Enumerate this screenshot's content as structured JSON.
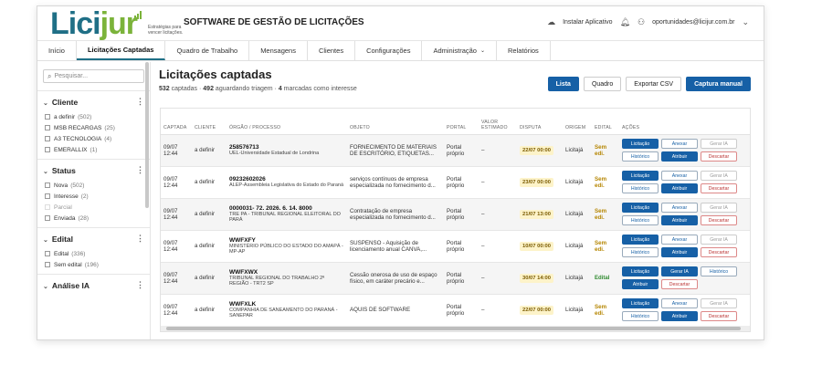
{
  "app": {
    "logo_text_a": "Lici",
    "logo_text_b": "jur",
    "logo_tagline": "Estratégias para vencer licitações.",
    "title": "SOFTWARE DE GESTÃO DE LICITAÇÕES",
    "install_label": "Instalar Aplicativo",
    "user_email": "oportunidades@licijur.com.br"
  },
  "tabs": [
    {
      "label": "Início"
    },
    {
      "label": "Licitações Captadas"
    },
    {
      "label": "Quadro de Trabalho"
    },
    {
      "label": "Mensagens"
    },
    {
      "label": "Clientes"
    },
    {
      "label": "Configurações"
    },
    {
      "label": "Administração"
    },
    {
      "label": "Relatórios"
    }
  ],
  "sidebar": {
    "search_placeholder": "Pesquisar...",
    "facets": {
      "cliente": {
        "title": "Cliente",
        "options": [
          {
            "label": "a definir",
            "count": "(502)"
          },
          {
            "label": "MSB RECARGAS",
            "count": "(25)"
          },
          {
            "label": "A3 TECNOLOGIA",
            "count": "(4)"
          },
          {
            "label": "EMERALLIX",
            "count": "(1)"
          }
        ]
      },
      "status": {
        "title": "Status",
        "options": [
          {
            "label": "Nova",
            "count": "(502)"
          },
          {
            "label": "Interesse",
            "count": "(2)"
          },
          {
            "label": "Parcial",
            "count": ""
          },
          {
            "label": "Enviada",
            "count": "(28)"
          }
        ]
      },
      "edital": {
        "title": "Edital",
        "options": [
          {
            "label": "Edital",
            "count": "(336)"
          },
          {
            "label": "Sem edital",
            "count": "(196)"
          }
        ]
      },
      "analise": {
        "title": "Análise IA"
      }
    }
  },
  "main": {
    "title": "Licitações captadas",
    "sub_count": "532",
    "sub_count_label": "captadas ·",
    "sub_triage": "492",
    "sub_triage_label": "aguardando triagem ·",
    "sub_interest": "4",
    "sub_interest_label": "marcadas como interesse",
    "buttons": {
      "lista": "Lista",
      "quadro": "Quadro",
      "export": "Exportar CSV",
      "manual": "Captura manual"
    }
  },
  "table": {
    "headers": [
      "CAPTADA",
      "CLIENTE",
      "ÓRGÃO / PROCESSO",
      "OBJETO",
      "PORTAL",
      "VALOR ESTIMADO",
      "DISPUTA",
      "ORIGEM",
      "EDITAL",
      "AÇÕES"
    ],
    "rows": [
      {
        "date": "09/07",
        "time": "12:44",
        "cliente": "a definir",
        "proc": "258576713",
        "org": "UEL-Universidade Estadual de Londrina",
        "obj": "FORNECIMENTO DE MATERIAIS DE ESCRITÓRIO, ETIQUETAS...",
        "portal": "Portal próprio",
        "valor": "–",
        "disputa": "22/07 00:00",
        "origem": "Licitajá",
        "edital": "Sem edi.",
        "edital_ok": false,
        "a1": "Licitação",
        "a2": "Anexar",
        "a3": "Gerar IA",
        "a4": "Histórico",
        "a5": "Atribuir",
        "a6": "Descartar"
      },
      {
        "date": "09/07",
        "time": "12:44",
        "cliente": "a definir",
        "proc": "09232602026",
        "org": "ALEP-Assembleia Legislativa do Estado do Paraná",
        "obj": "serviços contínuos de empresa especializada no fornecimento d...",
        "portal": "Portal próprio",
        "valor": "–",
        "disputa": "23/07 00:00",
        "origem": "Licitajá",
        "edital": "Sem edi.",
        "edital_ok": false,
        "a1": "Licitação",
        "a2": "Anexar",
        "a3": "Gerar IA",
        "a4": "Histórico",
        "a5": "Atribuir",
        "a6": "Descartar"
      },
      {
        "date": "09/07",
        "time": "12:44",
        "cliente": "a definir",
        "proc": "0000031- 72. 2026. 6. 14. 8000",
        "org": "TRE PA - TRIBUNAL REGIONAL ELEITORAL DO PARÁ",
        "obj": "Contratação de empresa especializada no fornecimento d...",
        "portal": "Portal próprio",
        "valor": "–",
        "disputa": "21/07 13:00",
        "origem": "Licitajá",
        "edital": "Sem edi.",
        "edital_ok": false,
        "a1": "Licitação",
        "a2": "Anexar",
        "a3": "Gerar IA",
        "a4": "Histórico",
        "a5": "Atribuir",
        "a6": "Descartar"
      },
      {
        "date": "09/07",
        "time": "12:44",
        "cliente": "a definir",
        "proc": "WWFXFY",
        "org": "MINISTÉRIO PÚBLICO DO ESTADO DO AMAPÁ - MP-AP",
        "obj": "SUSPENSO - Aquisição de licenciamento anual CANVA,...",
        "portal": "Portal próprio",
        "valor": "–",
        "disputa": "10/07 00:00",
        "origem": "Licitajá",
        "edital": "Sem edi.",
        "edital_ok": false,
        "a1": "Licitação",
        "a2": "Anexar",
        "a3": "Gerar IA",
        "a4": "Histórico",
        "a5": "Atribuir",
        "a6": "Descartar"
      },
      {
        "date": "09/07",
        "time": "12:44",
        "cliente": "a definir",
        "proc": "WWFXWX",
        "org": "TRIBUNAL REGIONAL DO TRABALHO 2ª REGIÃO - TRT2 SP",
        "obj": "Cessão onerosa de uso de espaço físico, em caráter precário e...",
        "portal": "Portal próprio",
        "valor": "–",
        "disputa": "30/07 14:00",
        "origem": "Licitajá",
        "edital": "Edital",
        "edital_ok": true,
        "a1": "Licitação",
        "a2": "Gerar IA",
        "a3": "Histórico",
        "a4": "Atribuir",
        "a5": "Descartar",
        "a6": ""
      },
      {
        "date": "09/07",
        "time": "12:44",
        "cliente": "a definir",
        "proc": "WWFXLK",
        "org": "COMPANHIA DE SANEAMENTO DO PARANÁ - SANEPAR",
        "obj": "AQUIS DE SOFTWARE",
        "portal": "Portal próprio",
        "valor": "–",
        "disputa": "22/07 00:00",
        "origem": "Licitajá",
        "edital": "Sem edi.",
        "edital_ok": false,
        "a1": "Licitação",
        "a2": "Anexar",
        "a3": "Gerar IA",
        "a4": "Histórico",
        "a5": "Atribuir",
        "a6": "Descartar"
      }
    ]
  },
  "icons": {
    "search": "search-icon",
    "install": "cloud-download-icon",
    "bell": "bell-icon",
    "user": "user-icon",
    "chevron": "chevron-down-icon",
    "kebab": "kebab-icon"
  }
}
